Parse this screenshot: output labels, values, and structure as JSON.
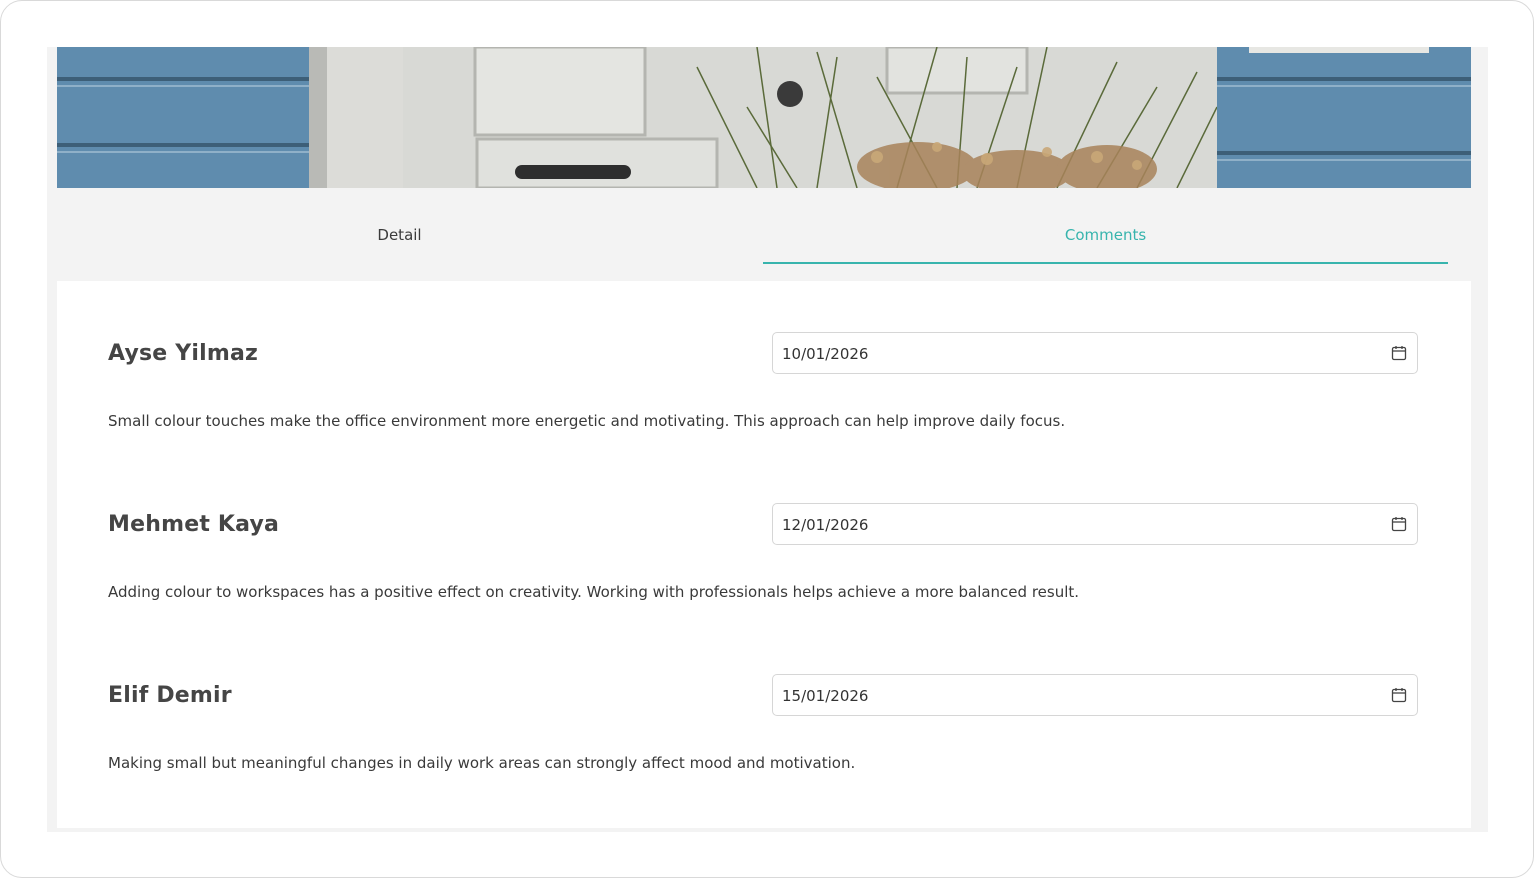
{
  "tabs": [
    {
      "label": "Detail",
      "active": false
    },
    {
      "label": "Comments",
      "active": true
    }
  ],
  "accent_color": "#37b4ad",
  "hero_image": {
    "description_icon": "door-photo"
  },
  "comments": [
    {
      "author": "Ayse Yilmaz",
      "date": "10/01/2026",
      "text": "Small colour touches make the office environment more energetic and motivating. This approach can help improve daily focus."
    },
    {
      "author": "Mehmet Kaya",
      "date": "12/01/2026",
      "text": "Adding colour to workspaces has a positive effect on creativity. Working with professionals helps achieve a more balanced result."
    },
    {
      "author": "Elif Demir",
      "date": "15/01/2026",
      "text": "Making small but meaningful changes in daily work areas can strongly affect mood and motivation."
    }
  ]
}
